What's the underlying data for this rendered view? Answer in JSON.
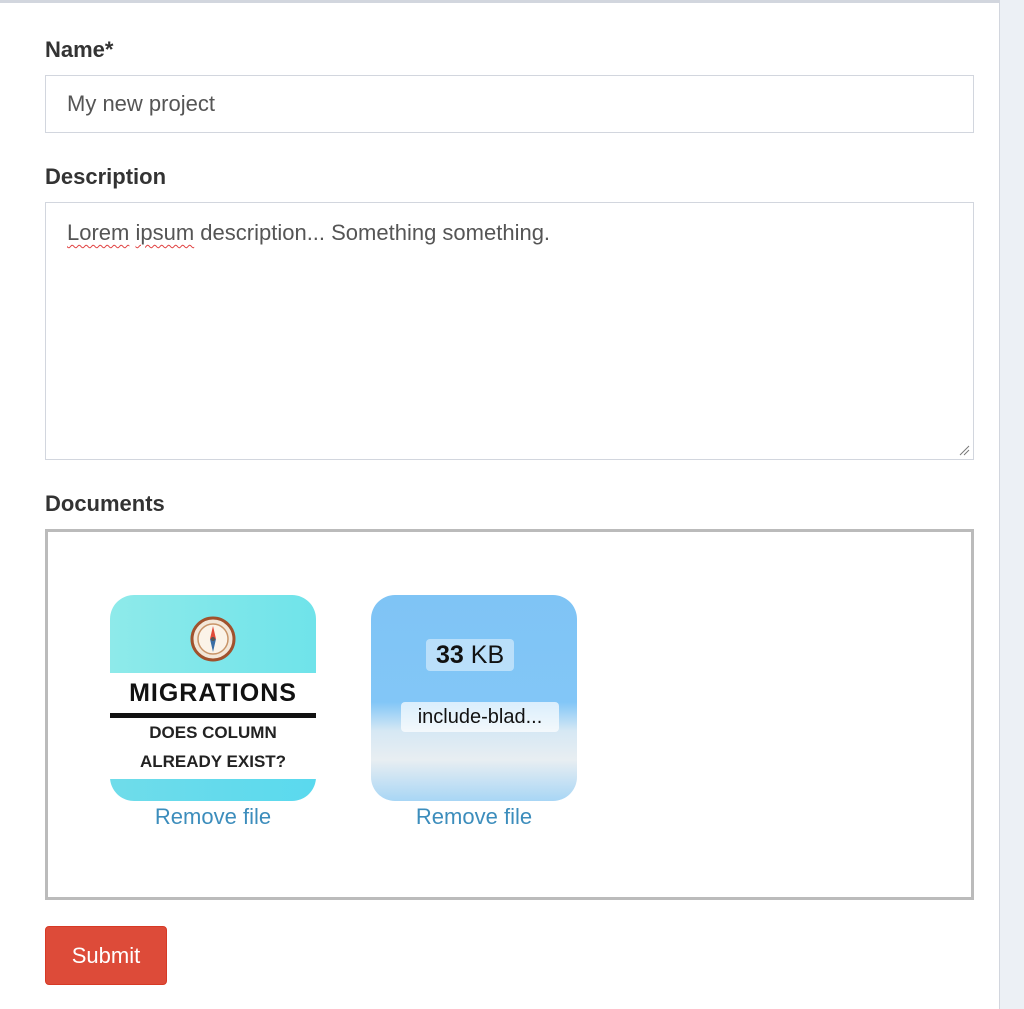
{
  "form": {
    "name_label": "Name*",
    "name_value": "My new project",
    "description_label": "Description",
    "description_words": [
      "Lorem",
      "ipsum",
      "description... Something something."
    ],
    "documents_label": "Documents",
    "submit_label": "Submit"
  },
  "documents": [
    {
      "thumbnail_title": "MIGRATIONS",
      "thumbnail_line1": "DOES COLUMN",
      "thumbnail_line2": "ALREADY EXIST?",
      "icon": "compass-icon",
      "remove_label": "Remove file"
    },
    {
      "size_number": "33",
      "size_unit": "KB",
      "filename": "include-blad...",
      "remove_label": "Remove file"
    }
  ],
  "colors": {
    "submit": "#dd4b39",
    "link": "#3c8dbc",
    "background": "#ecf0f5"
  }
}
